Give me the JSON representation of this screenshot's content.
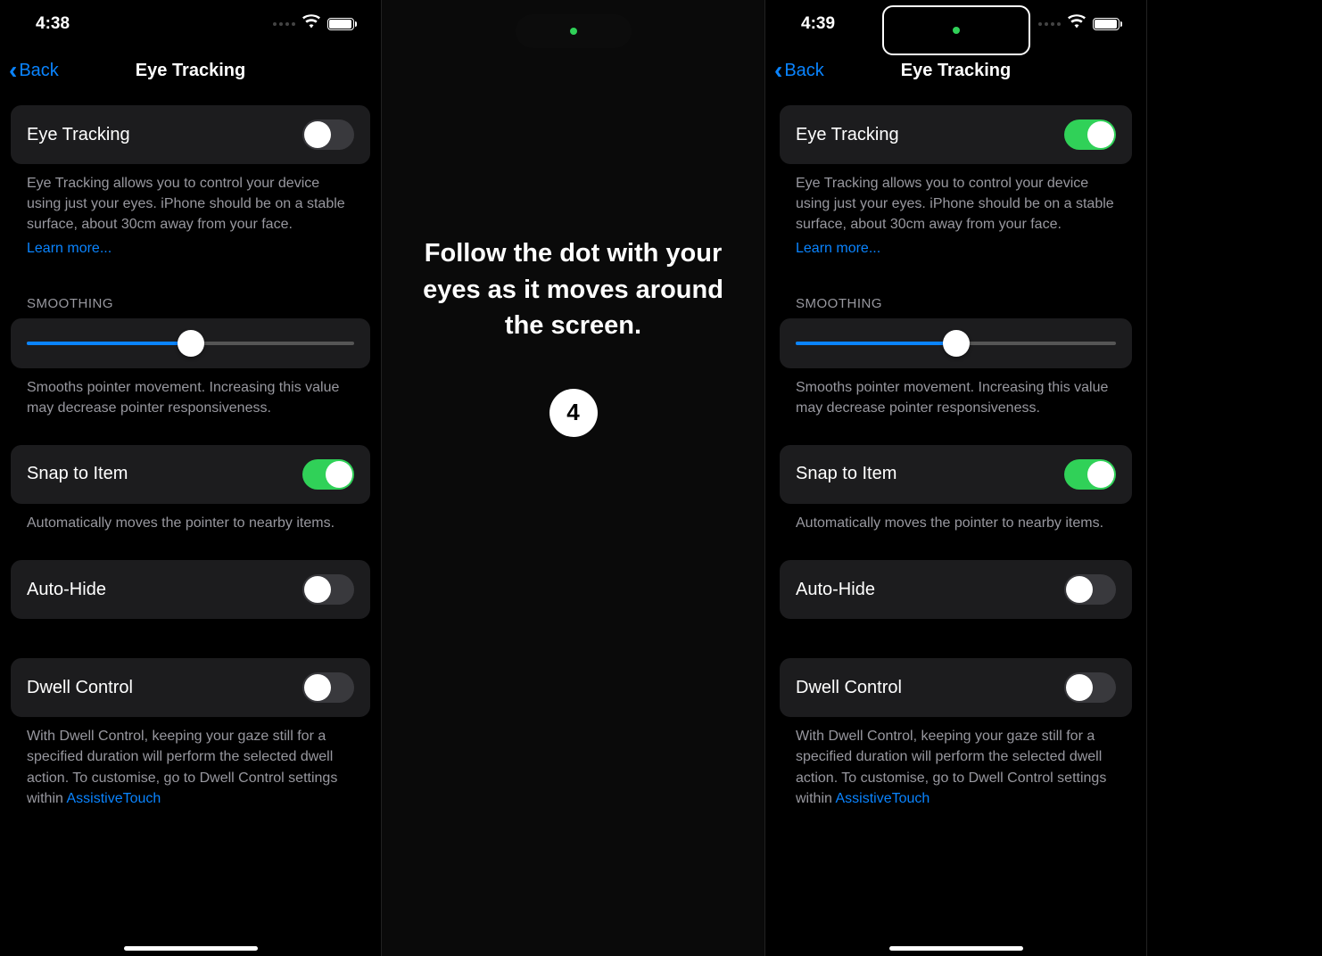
{
  "left": {
    "status_time": "4:38",
    "nav_back": "Back",
    "nav_title": "Eye Tracking",
    "eye_tracking": {
      "label": "Eye Tracking",
      "on": false
    },
    "eye_tracking_desc": "Eye Tracking allows you to control your device using just your eyes. iPhone should be on a stable surface, about 30cm away from your face.",
    "learn_more": "Learn more...",
    "smoothing_header": "SMOOTHING",
    "smoothing_value_pct": 50,
    "smoothing_desc": "Smooths pointer movement. Increasing this value may decrease pointer responsiveness.",
    "snap": {
      "label": "Snap to Item",
      "on": true
    },
    "snap_desc": "Automatically moves the pointer to nearby items.",
    "autohide": {
      "label": "Auto-Hide",
      "on": false
    },
    "dwell": {
      "label": "Dwell Control",
      "on": false
    },
    "dwell_desc_pre": "With Dwell Control, keeping your gaze still for a specified duration will perform the selected dwell action. To customise, go to Dwell Control settings within ",
    "dwell_desc_link": "AssistiveTouch"
  },
  "middle": {
    "calibration_text": "Follow the dot with your eyes as it moves around the screen.",
    "countdown": "4"
  },
  "right": {
    "status_time": "4:39",
    "nav_back": "Back",
    "nav_title": "Eye Tracking",
    "eye_tracking": {
      "label": "Eye Tracking",
      "on": true
    },
    "eye_tracking_desc": "Eye Tracking allows you to control your device using just your eyes. iPhone should be on a stable surface, about 30cm away from your face.",
    "learn_more": "Learn more...",
    "smoothing_header": "SMOOTHING",
    "smoothing_value_pct": 50,
    "smoothing_desc": "Smooths pointer movement. Increasing this value may decrease pointer responsiveness.",
    "snap": {
      "label": "Snap to Item",
      "on": true
    },
    "snap_desc": "Automatically moves the pointer to nearby items.",
    "autohide": {
      "label": "Auto-Hide",
      "on": false
    },
    "dwell": {
      "label": "Dwell Control",
      "on": false
    },
    "dwell_desc_pre": "With Dwell Control, keeping your gaze still for a specified duration will perform the selected dwell action. To customise, go to Dwell Control settings within ",
    "dwell_desc_link": "AssistiveTouch"
  }
}
